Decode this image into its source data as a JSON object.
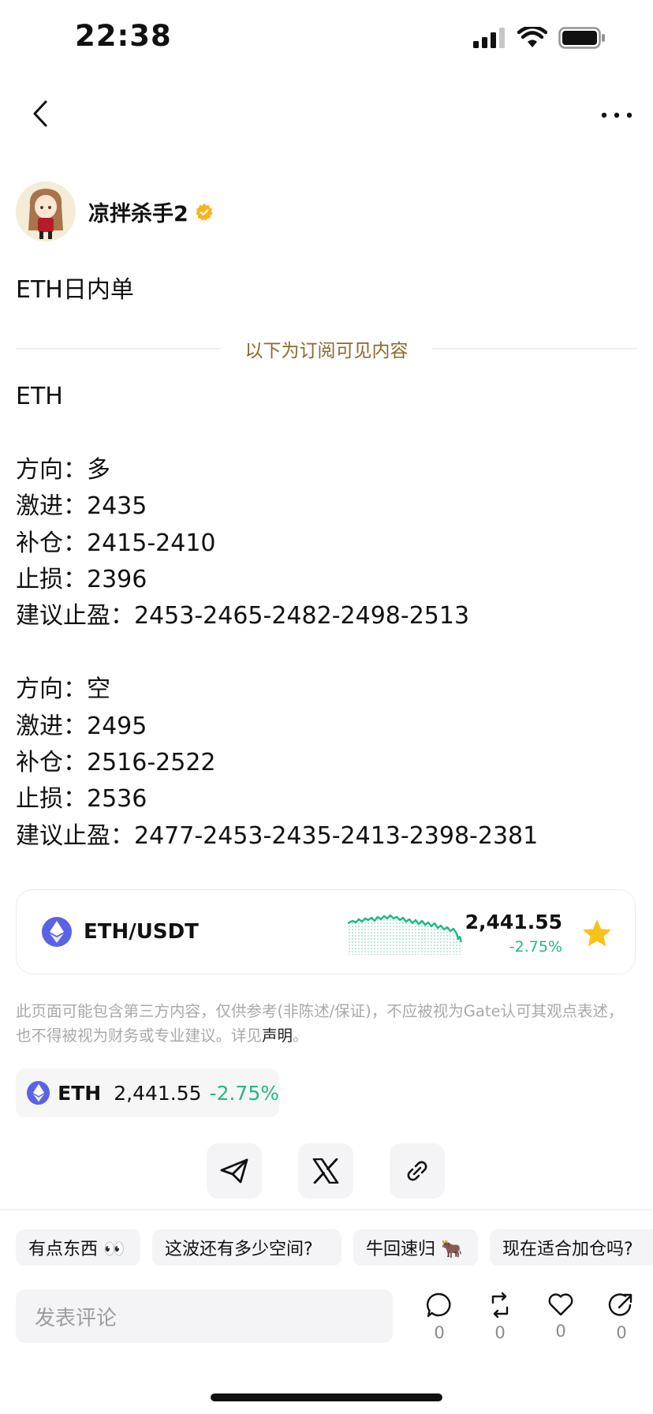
{
  "status_bar": {
    "time": "22:38"
  },
  "author": {
    "name": "凉拌杀手2"
  },
  "post": {
    "title": "ETH日内单",
    "subscribe_divider": "以下为订阅可见内容",
    "lines": [
      "ETH",
      "",
      "方向：多",
      "激进：2435",
      "补仓：2415-2410",
      "止损：2396",
      "建议止盈：2453-2465-2482-2498-2513",
      "",
      "方向：空",
      "激进：2495",
      "补仓：2516-2522",
      "止损：2536",
      "建议止盈：2477-2453-2435-2413-2398-2381"
    ]
  },
  "market_card": {
    "pair": "ETH/USDT",
    "price": "2,441.55",
    "change": "-2.75%",
    "up_color": "#1fb983",
    "favorite_color": "#f7c21a"
  },
  "disclaimer": {
    "text": "此页面可能包含第三方内容，仅供参考(非陈述/保证)，不应被视为Gate认可其观点表述，也不得被视为财务或专业建议。详见",
    "link": "声明",
    "end": "。"
  },
  "coin_chip": {
    "symbol": "ETH",
    "price": "2,441.55",
    "change": "-2.75%"
  },
  "share": {
    "buttons": [
      "telegram-icon",
      "x-icon",
      "link-icon"
    ]
  },
  "quick_replies": [
    "有点东西 👀",
    "这波还有多少空间?",
    "牛回速归 🐂",
    "现在适合加仓吗?"
  ],
  "comment": {
    "placeholder": "发表评论"
  },
  "actions": {
    "comments": "0",
    "reposts": "0",
    "likes": "0",
    "shares": "0"
  }
}
